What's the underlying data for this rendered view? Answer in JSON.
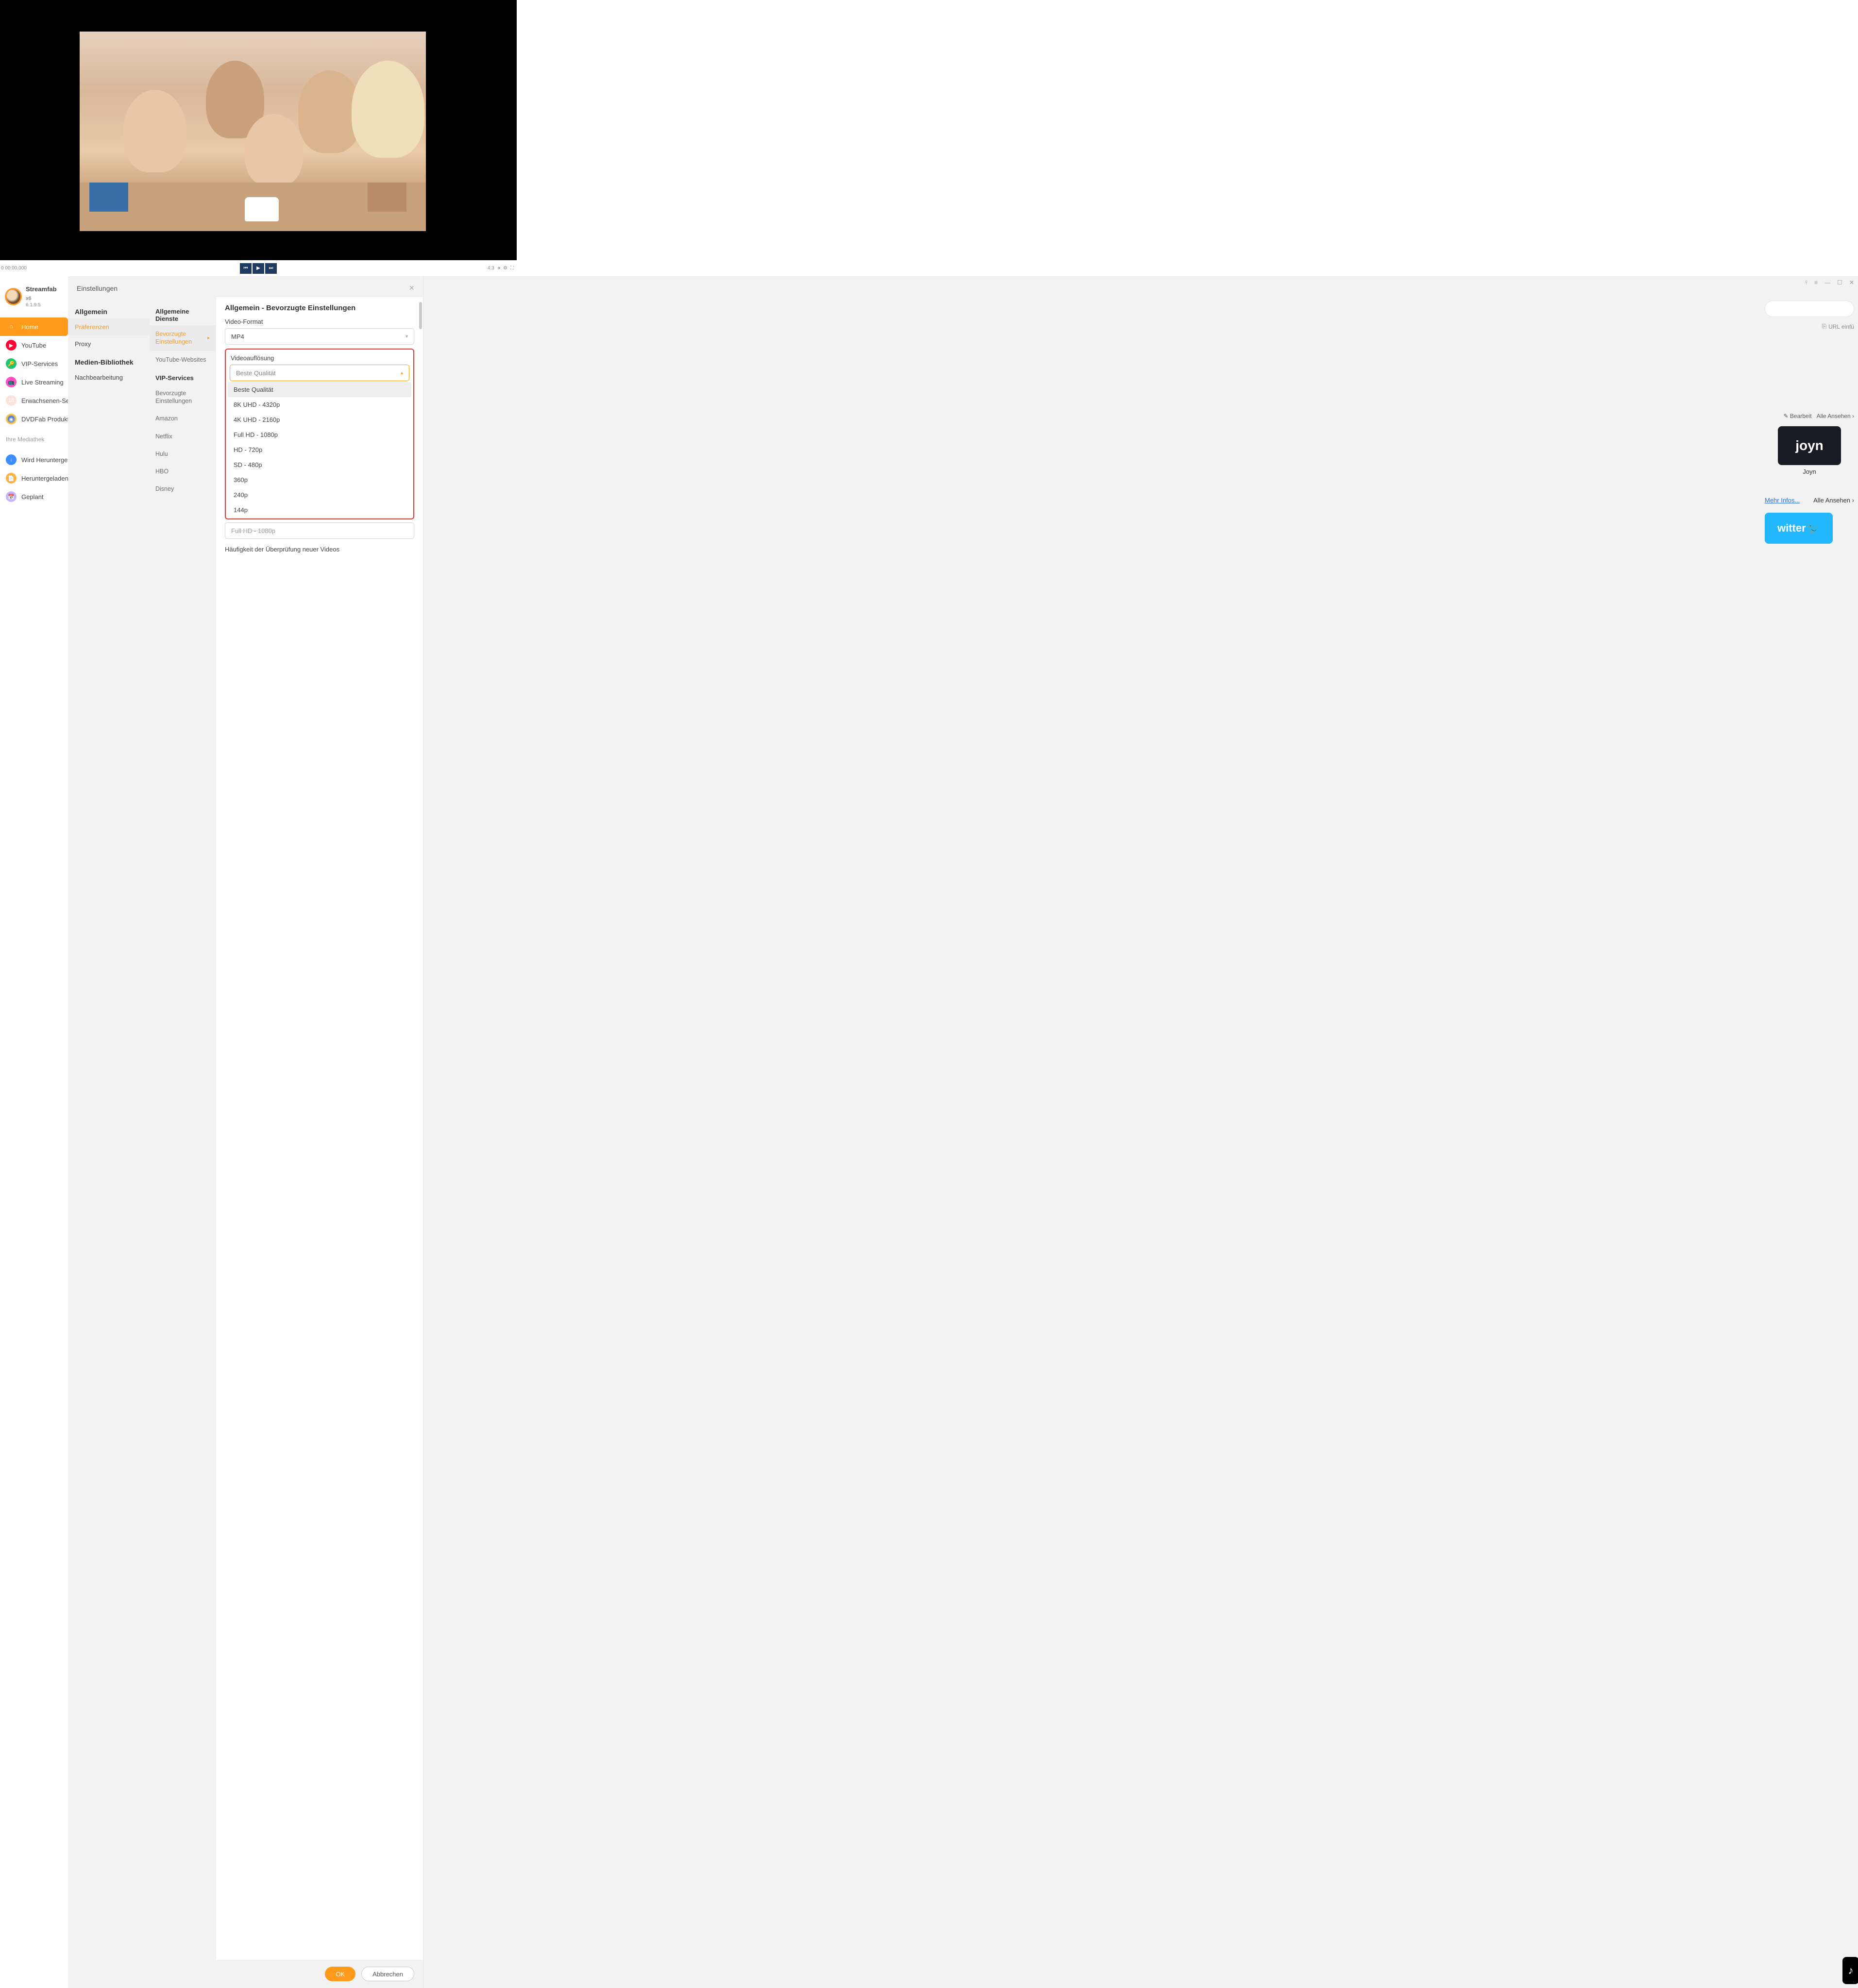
{
  "player": {
    "timecode": "0 00:00.000",
    "aspect": "4:3"
  },
  "brand": {
    "name": "Streamfab",
    "suffix": "x6",
    "version": "6.1.9.5"
  },
  "sidebar": {
    "items": [
      {
        "label": "Home"
      },
      {
        "label": "YouTube"
      },
      {
        "label": "VIP-Services"
      },
      {
        "label": "Live Streaming"
      },
      {
        "label": "Erwachsenen-Se"
      },
      {
        "label": "DVDFab Produkt"
      }
    ],
    "library_header": "Ihre Mediathek",
    "library": [
      {
        "label": "Wird Heruntergel"
      },
      {
        "label": "Heruntergeladen"
      },
      {
        "label": "Geplant"
      }
    ]
  },
  "bg": {
    "url_paste": "URL einfü",
    "edit": "Bearbeit",
    "view_all": "Alle Ansehen",
    "joyn": "Joyn",
    "more_info": "Mehr Infos...",
    "view_all2": "Alle Ansehen",
    "twitter": "witter"
  },
  "modal": {
    "title": "Einstellungen",
    "col1": {
      "sec1": "Allgemein",
      "items1": [
        "Präferenzen",
        "Proxy"
      ],
      "sec2": "Medien-Bibliothek",
      "items2": [
        "Nachbearbeitung"
      ]
    },
    "col2": {
      "sec1": "Allgemeine Dienste",
      "items1": [
        "Bevorzugte Einstellungen",
        "YouTube-Websites"
      ],
      "sec2": "VIP-Services",
      "items2": [
        "Bevorzugte Einstellungen",
        "Amazon",
        "Netflix",
        "Hulu",
        "HBO",
        "Disney"
      ]
    },
    "panel": {
      "title": "Allgemein - Bevorzugte Einstellungen",
      "video_format_label": "Video-Format",
      "video_format_value": "MP4",
      "resolution_label": "Videoauflösung",
      "resolution_value": "Beste Qualität",
      "resolution_options": [
        "Beste Qualität",
        "8K UHD - 4320p",
        "4K UHD - 2160p",
        "Full HD - 1080p",
        "HD - 720p",
        "SD - 480p",
        "360p",
        "240p",
        "144p"
      ],
      "covered_value": "Full HD - 1080p",
      "check_freq_label": "Häufigkeit der Überprüfung neuer Videos"
    },
    "footer": {
      "ok": "OK",
      "cancel": "Abbrechen"
    }
  }
}
